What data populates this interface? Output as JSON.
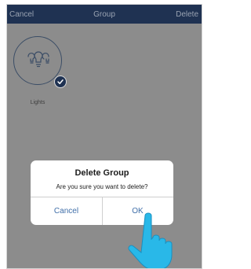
{
  "navbar": {
    "cancel_label": "Cancel",
    "title": "Group",
    "delete_label": "Delete"
  },
  "group_tile": {
    "label": "Lights",
    "icon": "light-bulbs-icon",
    "selected": true
  },
  "dialog": {
    "title": "Delete Group",
    "message": "Are you sure you want to delete?",
    "cancel_label": "Cancel",
    "ok_label": "OK"
  },
  "colors": {
    "navbar": "#1f3252",
    "overlay": "#8c8c8c",
    "dialog_button": "#3f6ea8",
    "hand": "#29b8e8"
  }
}
